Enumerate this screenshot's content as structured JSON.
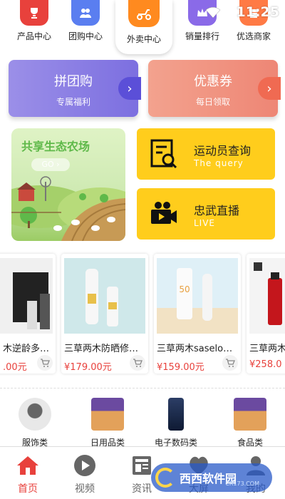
{
  "status": {
    "time": "11:25"
  },
  "top_nav": [
    {
      "label": "产品中心",
      "icon": "trophy-icon"
    },
    {
      "label": "团购中心",
      "icon": "group-icon"
    },
    {
      "label": "外卖中心",
      "icon": "delivery-icon"
    },
    {
      "label": "销量排行",
      "icon": "crown-icon"
    },
    {
      "label": "优选商家",
      "icon": "store-icon"
    }
  ],
  "promo": {
    "group": {
      "title": "拼团购",
      "subtitle": "专属福利"
    },
    "coupon": {
      "title": "优惠券",
      "subtitle": "每日领取"
    }
  },
  "farm": {
    "title": "共享生态农场",
    "go": "GO"
  },
  "athlete_query": {
    "title": "运动员查询",
    "subtitle": "The query"
  },
  "live": {
    "title": "忠武直播",
    "subtitle": "LIVE"
  },
  "products": [
    {
      "name": "木逆龄多…",
      "price": ".00元"
    },
    {
      "name": "三草两木防晒修…",
      "price": "¥179.00元"
    },
    {
      "name": "三草两木saselo…",
      "price": "¥159.00元"
    },
    {
      "name": "三草两木",
      "price": "¥258.0"
    }
  ],
  "categories": [
    {
      "label": "服饰类"
    },
    {
      "label": "日用品类"
    },
    {
      "label": "电子数码类"
    },
    {
      "label": "食品类"
    }
  ],
  "tabs": [
    {
      "label": "首页",
      "active": true
    },
    {
      "label": "视频",
      "active": false
    },
    {
      "label": "资讯",
      "active": false
    },
    {
      "label": "大屏",
      "active": false
    },
    {
      "label": "我的",
      "active": false
    }
  ],
  "watermark": {
    "text": "西西软件园",
    "sub": "CR173.COM"
  },
  "colors": {
    "accent": "#e8413c",
    "yellow": "#ffcd1c",
    "purple": "#7c6fe0",
    "salmon": "#ee8675"
  }
}
